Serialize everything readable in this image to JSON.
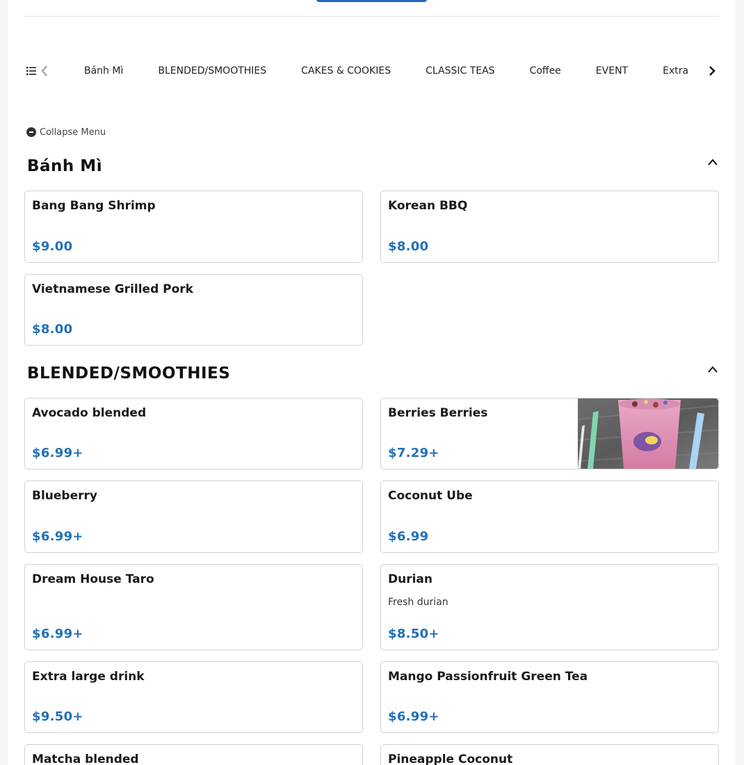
{
  "category_nav": {
    "tabs": [
      "Bánh Mì",
      "BLENDED/SMOOTHIES",
      "CAKES & COOKIES",
      "CLASSIC TEAS",
      "Coffee",
      "EVENT",
      "Extra"
    ],
    "list_icon": "list-icon",
    "prev_icon": "chevron-left-icon",
    "next_icon": "chevron-right-icon"
  },
  "collapse_menu": {
    "label": "Collapse Menu",
    "icon": "minus-circle-icon"
  },
  "sections": [
    {
      "title": "Bánh Mì",
      "items": [
        {
          "name": "Bang Bang Shrimp",
          "price": "$9.00"
        },
        {
          "name": "Korean BBQ",
          "price": "$8.00"
        },
        {
          "name": "Vietnamese Grilled Pork",
          "price": "$8.00"
        }
      ]
    },
    {
      "title": "BLENDED/SMOOTHIES",
      "items": [
        {
          "name": "Avocado blended",
          "price": "$6.99+"
        },
        {
          "name": "Berries Berries",
          "price": "$7.29+"
        },
        {
          "name": "Blueberry",
          "price": "$6.99+"
        },
        {
          "name": "Coconut Ube",
          "price": "$6.99"
        },
        {
          "name": "Dream House Taro",
          "price": "$6.99+"
        },
        {
          "name": "Durian",
          "description": "Fresh durian",
          "price": "$8.50+"
        },
        {
          "name": "Extra large drink",
          "price": "$9.50+"
        },
        {
          "name": "Mango Passionfruit Green Tea",
          "price": "$6.99+"
        },
        {
          "name": "Matcha blended"
        },
        {
          "name": "Pineapple Coconut"
        }
      ]
    }
  ],
  "colors": {
    "price": "#2170b8",
    "accent": "#1f6bc1",
    "border": "#d2d2d2"
  }
}
